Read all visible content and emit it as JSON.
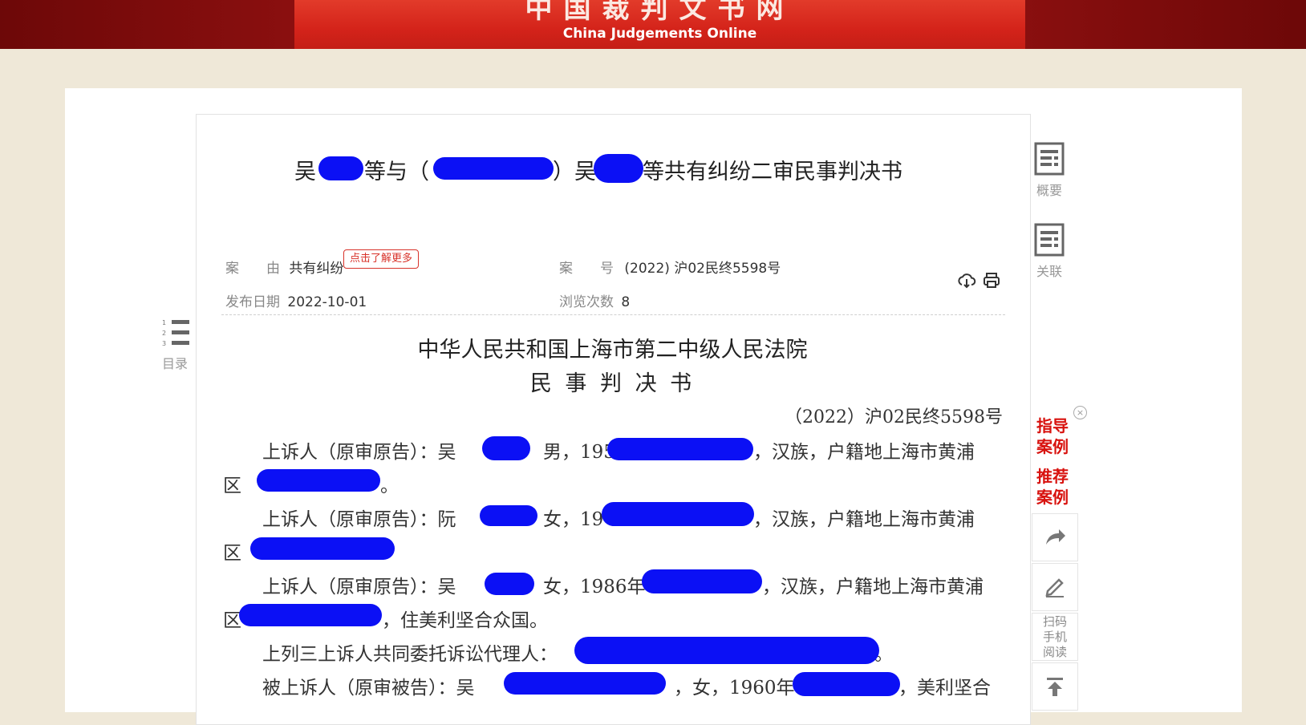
{
  "header": {
    "site_name_cn": "中国裁判文书网",
    "site_name_en": "China Judgements Online"
  },
  "document": {
    "title_parts": [
      "吴",
      "等与（",
      "）吴",
      "等共有纠纷二审民事判决书"
    ],
    "meta": {
      "cause_label": "案　　由",
      "cause_value": "共有纠纷",
      "learn_more": "点击了解更多",
      "case_no_label": "案　　号",
      "case_no_value": "(2022) 沪02民终5598号",
      "publish_label": "发布日期",
      "publish_value": "2022-10-01",
      "views_label": "浏览次数",
      "views_value": "8"
    },
    "court_name": "中华人民共和国上海市第二中级人民法院",
    "doc_type": "民 事 判 决 书",
    "case_number": "（2022）沪02民终5598号",
    "paragraphs": [
      {
        "a": "上诉人（原审原告）：吴",
        "b": "男，195",
        "c": "，汉族，户籍地上海市黄浦"
      },
      {
        "a": "区",
        "b": "。"
      },
      {
        "a": "上诉人（原审原告）：阮",
        "b": "女，19",
        "c": "，汉族，户籍地上海市黄浦"
      },
      {
        "a": "区"
      },
      {
        "a": "上诉人（原审原告）：吴",
        "b": "女，1986年",
        "c": "，汉族，户籍地上海市黄浦"
      },
      {
        "a": "区",
        "b": "，住美利坚合众国。"
      },
      {
        "a": "上列三上诉人共同委托诉讼代理人：",
        "b": "。"
      },
      {
        "a": "被上诉人（原审被告）：吴",
        "b": "，女，1960年",
        "c": "，美利坚合"
      }
    ]
  },
  "toolbar": {
    "summary_label": "概要",
    "related_label": "关联",
    "toc_label": "目录",
    "guide_cases": "指导案例",
    "recommend_cases": "推荐案例",
    "scan_read": "扫码手机阅读"
  },
  "icons": {
    "download": "download-icon",
    "print": "print-icon",
    "share": "share-icon",
    "edit": "edit-icon",
    "top": "back-to-top-icon"
  },
  "colors": {
    "banner_red": "#d4231a",
    "redaction_blue": "#0b10f5",
    "link_red": "#d8120e"
  }
}
